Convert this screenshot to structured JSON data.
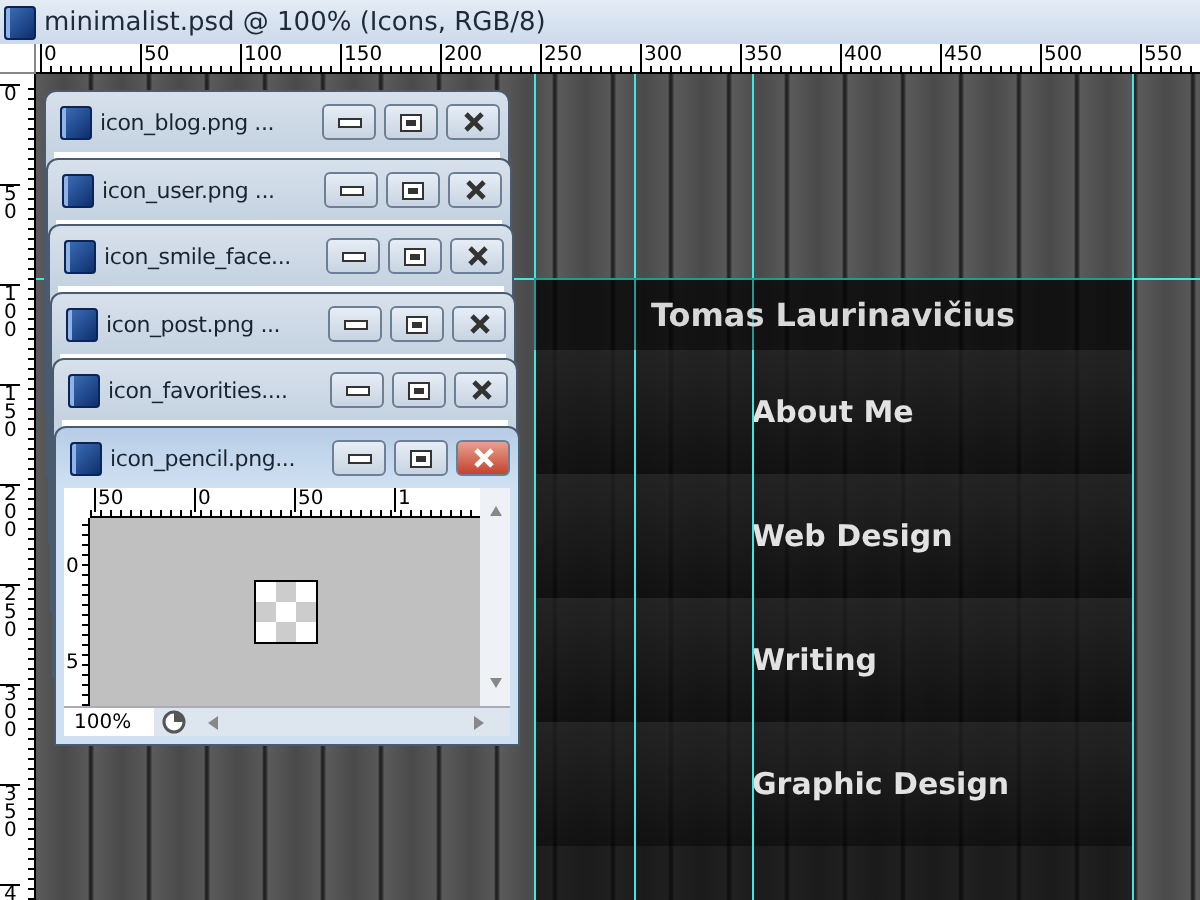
{
  "window": {
    "title": "minimalist.psd @ 100% (Icons, RGB/8)"
  },
  "ruler": {
    "horizontal": [
      "0",
      "50",
      "100",
      "150",
      "200",
      "250",
      "300",
      "350",
      "400",
      "450",
      "500",
      "550"
    ],
    "vertical": [
      "0",
      "50",
      "100",
      "150",
      "200",
      "250",
      "300",
      "350",
      "4"
    ]
  },
  "document": {
    "heading": "Tomas Laurinavičius",
    "menu": [
      "About Me",
      "Web Design",
      "Writing",
      "Graphic Design"
    ]
  },
  "panels": [
    {
      "title": "icon_blog.png ...",
      "active": false
    },
    {
      "title": "icon_user.png ...",
      "active": false
    },
    {
      "title": "icon_smile_face...",
      "active": false
    },
    {
      "title": "icon_post.png ...",
      "active": false
    },
    {
      "title": "icon_favorities....",
      "active": false
    },
    {
      "title": "icon_pencil.png...",
      "active": true,
      "ruler_horizontal": [
        "50",
        "0",
        "50",
        "1"
      ],
      "ruler_vertical": [
        "0",
        "5"
      ],
      "zoom": "100%"
    }
  ]
}
